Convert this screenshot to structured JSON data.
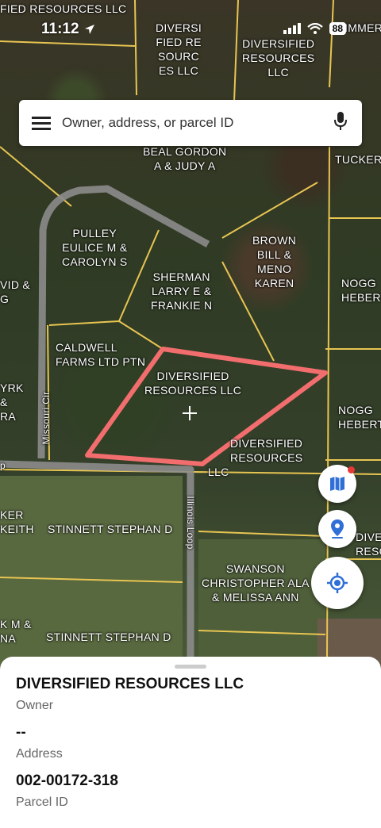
{
  "status_bar": {
    "time": "11:12",
    "battery": "88"
  },
  "search": {
    "placeholder": "Owner, address, or parcel ID"
  },
  "map": {
    "parcel_labels": [
      "FIED RESOURCES LLC",
      "DIVERSI\nFIED RE\nSOURC\nES LLC",
      "DIVERSIFIED\nRESOURCES\nLLC",
      "IMMER",
      "BEAL GORDON\nA & JUDY A",
      "TUCKER",
      "PULLEY\nEULICE M &\nCAROLYN S",
      "BROWN\nBILL &\nMENO\nKAREN",
      "VID &\nG",
      "NOGG\nHEBERT",
      "SHERMAN\nLARRY E &\nFRANKIE N",
      "CALDWELL\nFARMS LTD PTN",
      "DIVERSIFIED\nRESOURCES LLC",
      "YRK\n&\nRA",
      "NOGG\nHEBERT",
      "DIVERSIFIED\nRESOURCES",
      "LLC",
      "KER\nKEITH",
      "STINNETT STEPHAN D",
      "DIVE\nRESO",
      "SWANSON\nCHRISTOPHER ALA\n& MELISSA ANN",
      "K M &\nNA",
      "STINNETT STEPHAN D"
    ],
    "roads": [
      "Missouri Cir",
      "Illinois Loop",
      "p"
    ],
    "accent_color": "#f26d6d"
  },
  "details": {
    "owner": "DIVERSIFIED RESOURCES LLC",
    "owner_label": "Owner",
    "address": "--",
    "address_label": "Address",
    "parcel_id": "002-00172-318",
    "parcel_label": "Parcel ID"
  },
  "icons": [
    "menu-icon",
    "microphone-icon",
    "map-layers-icon",
    "location-pin-icon",
    "my-location-icon",
    "crosshair-icon"
  ]
}
